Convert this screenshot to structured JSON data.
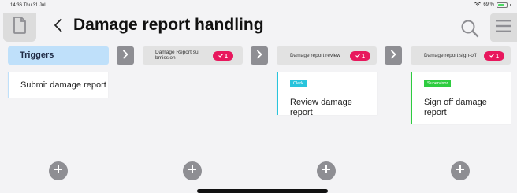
{
  "status_bar": {
    "time": "14:36 Thu 31 Jul",
    "battery": "69 %"
  },
  "header": {
    "title": "Damage report handling"
  },
  "colors": {
    "accent_blue": "#bfe0fa",
    "badge_red": "#e8175d",
    "clerk_cyan": "#29c4dc",
    "supervisor_green": "#2ecc40"
  },
  "columns": [
    {
      "label": "Triggers",
      "cards": [
        {
          "title": "Submit damage report",
          "role": ""
        }
      ]
    },
    {
      "label": "Damage Report submission",
      "badge": "1",
      "cards": []
    },
    {
      "label": "Damage report review",
      "badge": "1",
      "cards": [
        {
          "title": "Review damage report",
          "role": "Clerk"
        }
      ]
    },
    {
      "label": "Damage report sign-off",
      "badge": "1",
      "cards": [
        {
          "title": "Sign off damage report",
          "role": "Supervisor"
        }
      ]
    }
  ]
}
